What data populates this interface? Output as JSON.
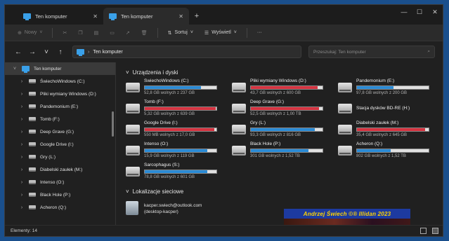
{
  "window": {
    "tabs": [
      {
        "label": "Ten komputer",
        "close": "✕"
      },
      {
        "label": "Ten komputer",
        "close": "✕"
      }
    ],
    "new_tab": "+",
    "controls": {
      "minimize": "—",
      "maximize": "☐",
      "close": "✕"
    }
  },
  "toolbar": {
    "new_label": "Nowy",
    "sort_label": "Sortuj",
    "view_label": "Wyświetl",
    "more_label": "···"
  },
  "nav": {
    "address": "Ten komputer",
    "search_placeholder": "Przeszukaj: Ten komputer"
  },
  "sidebar": {
    "items": [
      {
        "label": "Ten komputer"
      },
      {
        "label": "ŚwiechoWindows (C:)"
      },
      {
        "label": "Pliki wymiany Windows (D:)"
      },
      {
        "label": "Pandemonium (E:)"
      },
      {
        "label": "Tomb (F:)"
      },
      {
        "label": "Deep Grave (G:)"
      },
      {
        "label": "Google Drive (I:)"
      },
      {
        "label": "Gry (L:)"
      },
      {
        "label": "Diabelski zaułek (M:)"
      },
      {
        "label": "Intenso (O:)"
      },
      {
        "label": "Black Hole (P:)"
      },
      {
        "label": "Acheron (Q:)"
      }
    ]
  },
  "content": {
    "devices_title": "Urządzenia i dyski",
    "network_title": "Lokalizacje sieciowe",
    "drives": [
      {
        "name": "ŚwiechoWindows (C:)",
        "free": "52,8 GB wolnych z 237 GB",
        "used": 0.78,
        "red": false
      },
      {
        "name": "Pliki wymiany Windows (D:)",
        "free": "43,7 GB wolnych z 600 GB",
        "used": 0.93,
        "red": true
      },
      {
        "name": "Pandemonium (E:)",
        "free": "97,8 GB wolnych z 200 GB",
        "used": 0.51,
        "red": false
      },
      {
        "name": "Tomb (F:)",
        "free": "5,32 GB wolnych z 639 GB",
        "used": 0.99,
        "red": true
      },
      {
        "name": "Deep Grave (G:)",
        "free": "52,5 GB wolnych z 1,00 TB",
        "used": 0.95,
        "red": true
      },
      {
        "name": "Stacja dysków BD-RE (H:)",
        "free": "",
        "used": null,
        "red": false
      },
      {
        "name": "Google Drive (I:)",
        "free": "550 MB wolnych z 17,0 GB",
        "used": 0.97,
        "red": true
      },
      {
        "name": "Gry (L:)",
        "free": "93,3 GB wolnych z 816 GB",
        "used": 0.89,
        "red": false
      },
      {
        "name": "Diabelski zaułek (M:)",
        "free": "35,4 GB wolnych z 645 GB",
        "used": 0.95,
        "red": true
      },
      {
        "name": "Intenso (O:)",
        "free": "15,9 GB wolnych z 119 GB",
        "used": 0.87,
        "red": false
      },
      {
        "name": "Black Hole (P:)",
        "free": "301 GB wolnych z 1,52 TB",
        "used": 0.8,
        "red": false
      },
      {
        "name": "Acheron (Q:)",
        "free": "802 GB wolnych z 1,52 TB",
        "used": 0.47,
        "red": false
      },
      {
        "name": "Sarcophagus (S:)",
        "free": "78,8 GB wolnych z 601 GB",
        "used": 0.87,
        "red": false
      }
    ],
    "network": {
      "line1": "kacper.swiech@outlook.com",
      "line2": "(desktop-kacper)"
    },
    "banner": "Andrzej Świech ©® Illidan 2023"
  },
  "status": {
    "count": "Elementy: 14"
  },
  "colors": {
    "accent": "#2a8ad4",
    "warn": "#d53340"
  }
}
